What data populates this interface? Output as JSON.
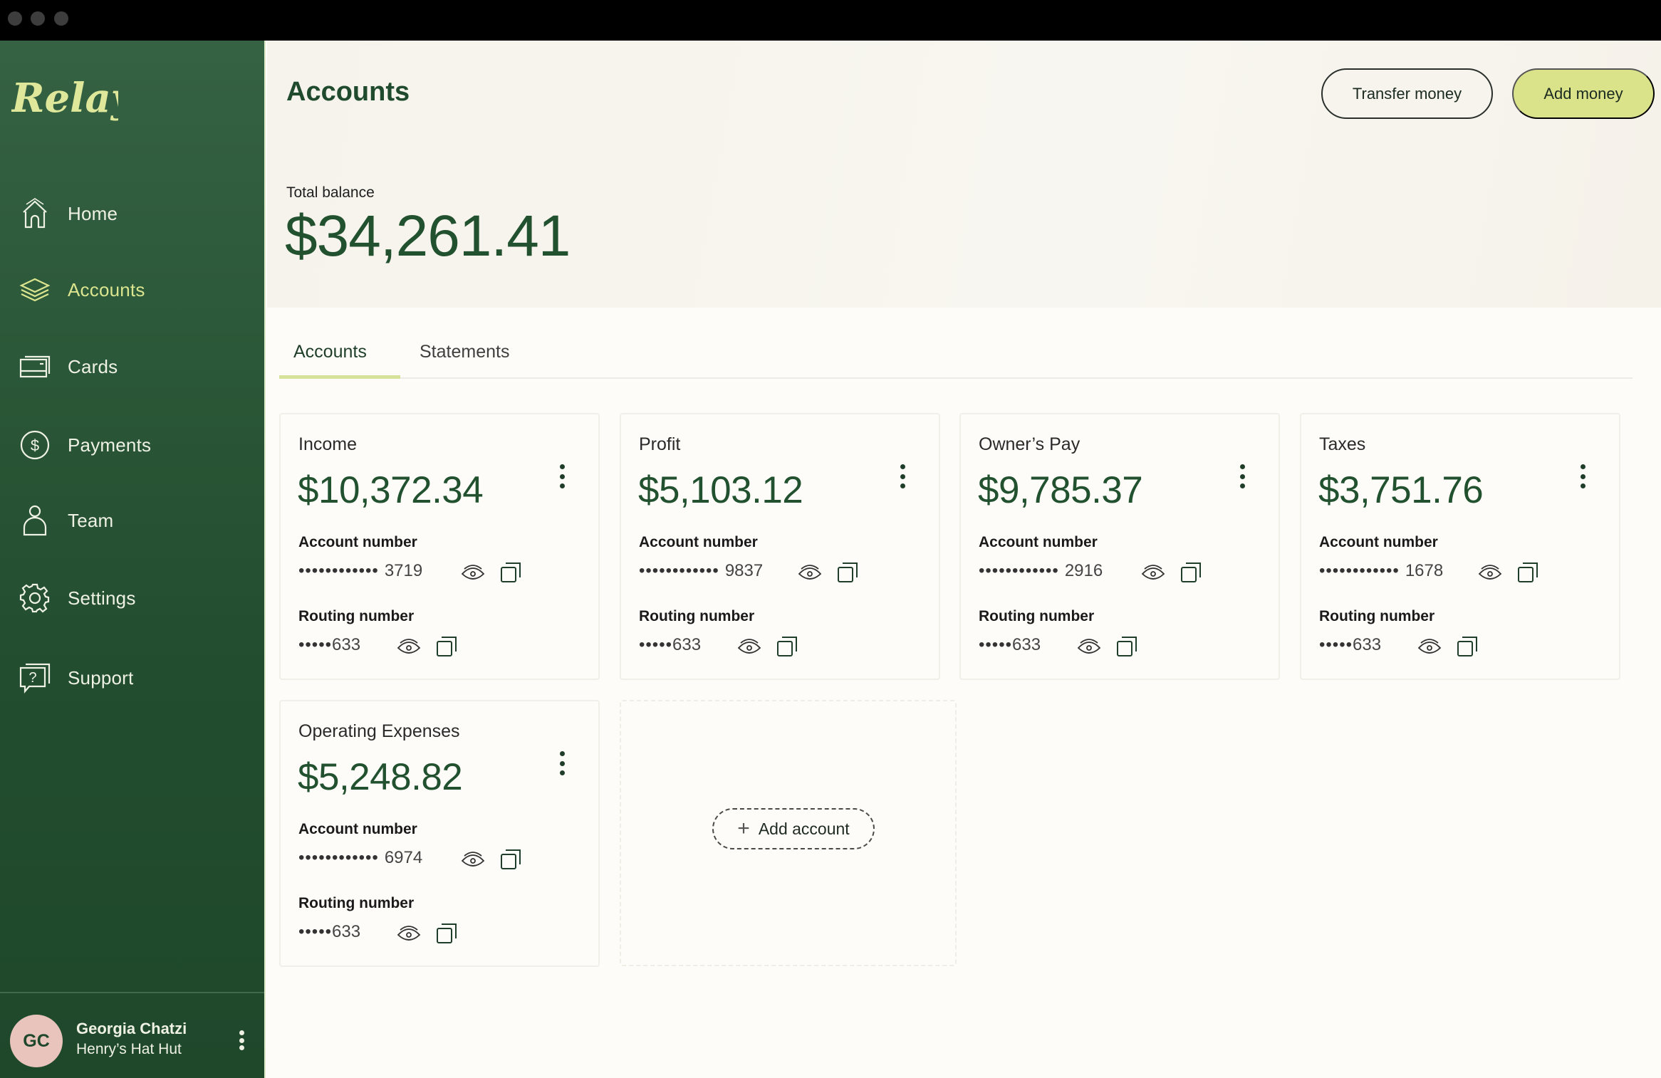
{
  "window": {
    "controls": [
      "close",
      "minimize",
      "maximize"
    ]
  },
  "brand": {
    "logo_text": "Relay",
    "accent_color": "#dae38a",
    "sidebar_color": "#234d2f",
    "money_color": "#22512f"
  },
  "sidebar": {
    "items": [
      {
        "label": "Home",
        "icon": "home-icon",
        "active": false
      },
      {
        "label": "Accounts",
        "icon": "layers-icon",
        "active": true
      },
      {
        "label": "Cards",
        "icon": "cards-icon",
        "active": false
      },
      {
        "label": "Payments",
        "icon": "dollar-circle-icon",
        "active": false
      },
      {
        "label": "Team",
        "icon": "person-icon",
        "active": false
      },
      {
        "label": "Settings",
        "icon": "gear-icon",
        "active": false
      },
      {
        "label": "Support",
        "icon": "help-chat-icon",
        "active": false
      }
    ],
    "profile": {
      "initials": "GC",
      "name": "Georgia Chatzi",
      "organization": "Henry’s Hat Hut"
    }
  },
  "header": {
    "title": "Accounts",
    "transfer_label": "Transfer money",
    "add_money_label": "Add money",
    "total_balance_label": "Total balance",
    "total_balance": "$34,261.41"
  },
  "tabs": [
    {
      "label": "Accounts",
      "active": true
    },
    {
      "label": "Statements",
      "active": false
    }
  ],
  "accounts": [
    {
      "name": "Income",
      "balance": "$10,372.34",
      "account_label": "Account number",
      "account_mask": "••••••••••••",
      "account_last4": "3719",
      "routing_label": "Routing number",
      "routing_mask": "•••••",
      "routing_last3": "633"
    },
    {
      "name": "Profit",
      "balance": "$5,103.12",
      "account_label": "Account number",
      "account_mask": "••••••••••••",
      "account_last4": "9837",
      "routing_label": "Routing number",
      "routing_mask": "•••••",
      "routing_last3": "633"
    },
    {
      "name": "Owner’s Pay",
      "balance": "$9,785.37",
      "account_label": "Account number",
      "account_mask": "••••••••••••",
      "account_last4": "2916",
      "routing_label": "Routing number",
      "routing_mask": "•••••",
      "routing_last3": "633"
    },
    {
      "name": "Taxes",
      "balance": "$3,751.76",
      "account_label": "Account number",
      "account_mask": "••••••••••••",
      "account_last4": "1678",
      "routing_label": "Routing number",
      "routing_mask": "•••••",
      "routing_last3": "633"
    },
    {
      "name": "Operating Expenses",
      "balance": "$5,248.82",
      "account_label": "Account number",
      "account_mask": "••••••••••••",
      "account_last4": "6974",
      "routing_label": "Routing number",
      "routing_mask": "•••••",
      "routing_last3": "633"
    }
  ],
  "add_account": {
    "label": "Add account",
    "icon": "plus-icon"
  }
}
